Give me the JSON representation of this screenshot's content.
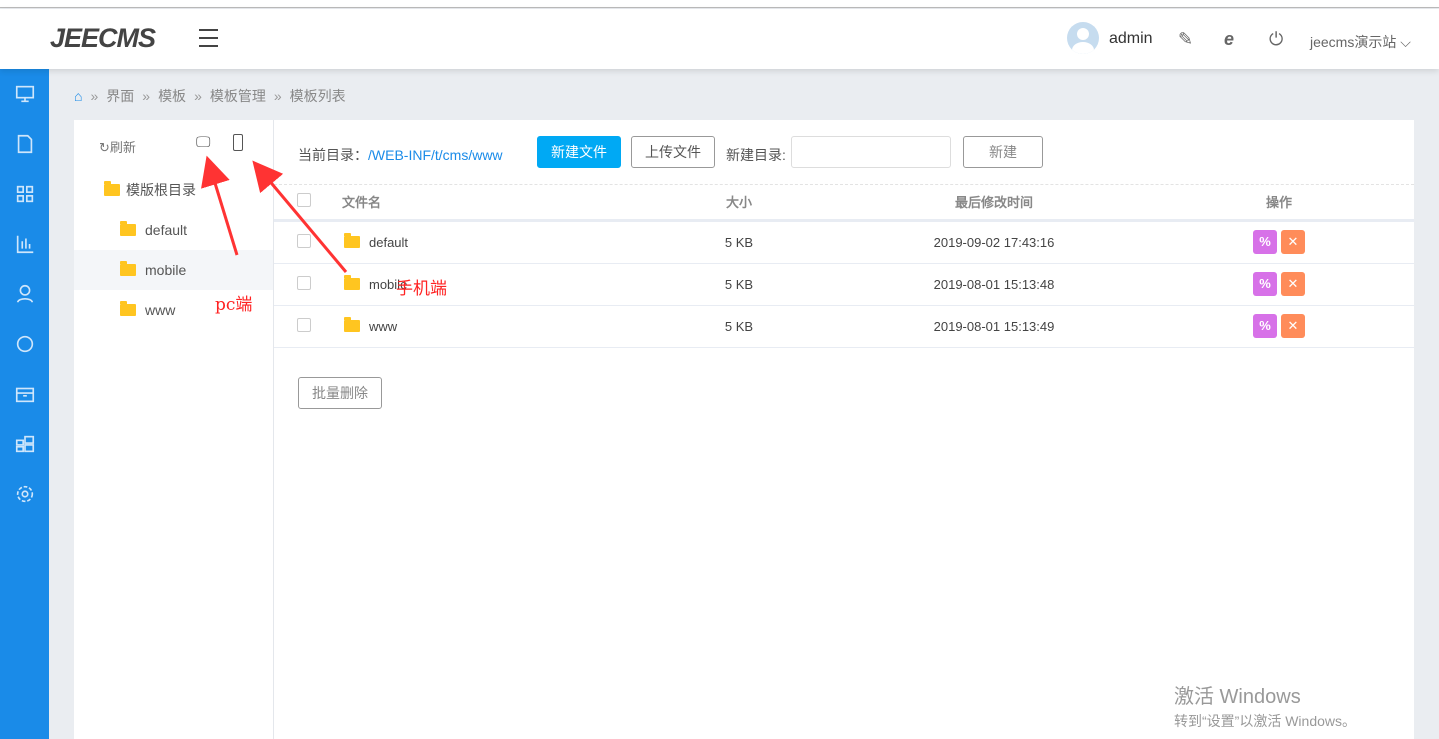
{
  "header": {
    "logo": "JEECMS",
    "user": "admin",
    "site": "jeecms演示站"
  },
  "sidebar": [
    "monitor-icon",
    "file-icon",
    "grid-icon",
    "chart-icon",
    "user-icon",
    "shield-icon",
    "package-icon",
    "apps-icon",
    "gear-icon"
  ],
  "breadcrumb": [
    "界面",
    "模板",
    "模板管理",
    "模板列表"
  ],
  "tree": {
    "refresh": "刷新",
    "root": "模版根目录",
    "items": [
      "default",
      "mobile",
      "www"
    ]
  },
  "toolbar": {
    "current_dir_label": "当前目录：",
    "current_dir": "/WEB-INF/t/cms/www",
    "new_file": "新建文件",
    "upload": "上传文件",
    "new_dir_label": "新建目录:",
    "new_dir_value": "",
    "create": "新建"
  },
  "table": {
    "headers": [
      "文件名",
      "大小",
      "最后修改时间",
      "操作"
    ],
    "rows": [
      {
        "name": "default",
        "size": "5 KB",
        "mtime": "2019-09-02 17:43:16"
      },
      {
        "name": "mobile",
        "size": "5 KB",
        "mtime": "2019-08-01 15:13:48"
      },
      {
        "name": "www",
        "size": "5 KB",
        "mtime": "2019-08-01 15:13:49"
      }
    ]
  },
  "batch_delete": "批量删除",
  "annotations": {
    "pc": "pc端",
    "mobile": "手机端"
  },
  "watermark": {
    "title": "激活 Windows",
    "sub": "转到“设置”以激活 Windows。"
  },
  "colors": {
    "sidebar": "#1a8be8",
    "primary": "#00a9f4",
    "edit": "#d771e8",
    "delete": "#ff8c5a"
  }
}
